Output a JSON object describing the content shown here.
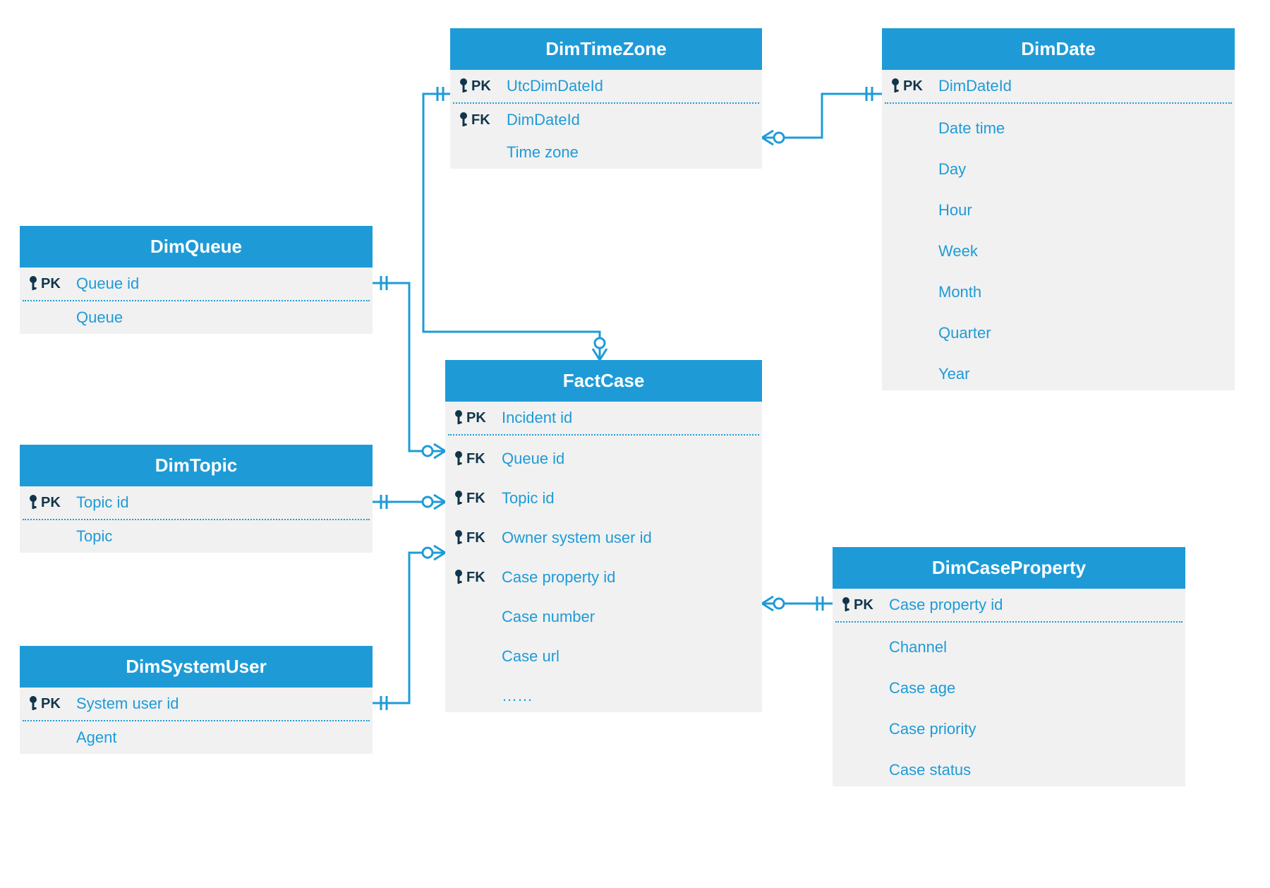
{
  "colors": {
    "accent": "#1e9bd7",
    "panel": "#f1f1f1",
    "keytext": "#10354a"
  },
  "entities": {
    "dimQueue": {
      "title": "DimQueue",
      "rows": [
        {
          "keytype": "PK",
          "label": "Queue id"
        },
        {
          "keytype": "",
          "label": "Queue"
        }
      ]
    },
    "dimTopic": {
      "title": "DimTopic",
      "rows": [
        {
          "keytype": "PK",
          "label": "Topic id"
        },
        {
          "keytype": "",
          "label": "Topic"
        }
      ]
    },
    "dimSystemUser": {
      "title": "DimSystemUser",
      "rows": [
        {
          "keytype": "PK",
          "label": "System user id"
        },
        {
          "keytype": "",
          "label": "Agent"
        }
      ]
    },
    "dimTimeZone": {
      "title": "DimTimeZone",
      "rows": [
        {
          "keytype": "PK",
          "label": "UtcDimDateId"
        },
        {
          "keytype": "FK",
          "label": "DimDateId"
        },
        {
          "keytype": "",
          "label": "Time zone"
        }
      ]
    },
    "factCase": {
      "title": "FactCase",
      "rows": [
        {
          "keytype": "PK",
          "label": "Incident id"
        },
        {
          "keytype": "FK",
          "label": "Queue id"
        },
        {
          "keytype": "FK",
          "label": "Topic id"
        },
        {
          "keytype": "FK",
          "label": "Owner system user id"
        },
        {
          "keytype": "FK",
          "label": "Case property id"
        },
        {
          "keytype": "",
          "label": "Case number"
        },
        {
          "keytype": "",
          "label": "Case url"
        },
        {
          "keytype": "",
          "label": "……"
        }
      ]
    },
    "dimDate": {
      "title": "DimDate",
      "rows": [
        {
          "keytype": "PK",
          "label": "DimDateId"
        },
        {
          "keytype": "",
          "label": "Date time"
        },
        {
          "keytype": "",
          "label": "Day"
        },
        {
          "keytype": "",
          "label": "Hour"
        },
        {
          "keytype": "",
          "label": "Week"
        },
        {
          "keytype": "",
          "label": "Month"
        },
        {
          "keytype": "",
          "label": "Quarter"
        },
        {
          "keytype": "",
          "label": "Year"
        }
      ]
    },
    "dimCaseProperty": {
      "title": "DimCaseProperty",
      "rows": [
        {
          "keytype": "PK",
          "label": "Case property id"
        },
        {
          "keytype": "",
          "label": "Channel"
        },
        {
          "keytype": "",
          "label": "Case age"
        },
        {
          "keytype": "",
          "label": "Case priority"
        },
        {
          "keytype": "",
          "label": "Case status"
        }
      ]
    }
  }
}
